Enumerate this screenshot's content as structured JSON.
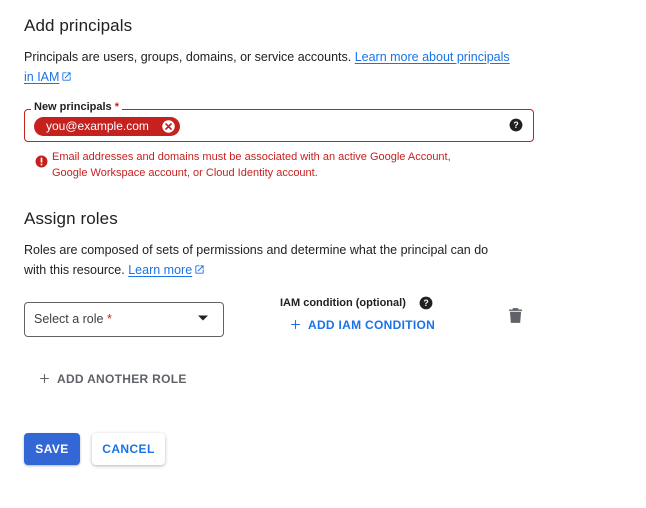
{
  "add_principals": {
    "title": "Add principals",
    "description": "Principals are users, groups, domains, or service accounts. ",
    "learn_more_line1": "Learn more about principals",
    "learn_more_line2": "in IAM",
    "field_label": "New principals",
    "required_mark": "*",
    "chip_value": "you@example.com",
    "error_line1": "Email addresses and domains must be associated with an active Google Account,",
    "error_line2": "Google Workspace account, or Cloud Identity account."
  },
  "assign_roles": {
    "title": "Assign roles",
    "description_line1": "Roles are composed of sets of permissions and determine what the principal can do",
    "description_line2": "with this resource. ",
    "learn_more": "Learn more",
    "select_placeholder": "Select a role",
    "required_mark": "*",
    "iam_condition_label": "IAM condition (optional)",
    "add_iam_condition": "ADD IAM CONDITION",
    "add_another_role": "ADD ANOTHER ROLE"
  },
  "actions": {
    "save": "SAVE",
    "cancel": "CANCEL"
  },
  "colors": {
    "primary": "#1a73e8",
    "save_bg": "#3367d6",
    "error": "#c5221f"
  },
  "icons": [
    "external-link-icon",
    "close-circle-icon",
    "help-icon",
    "error-icon",
    "dropdown-arrow-icon",
    "plus-icon",
    "trash-icon"
  ]
}
